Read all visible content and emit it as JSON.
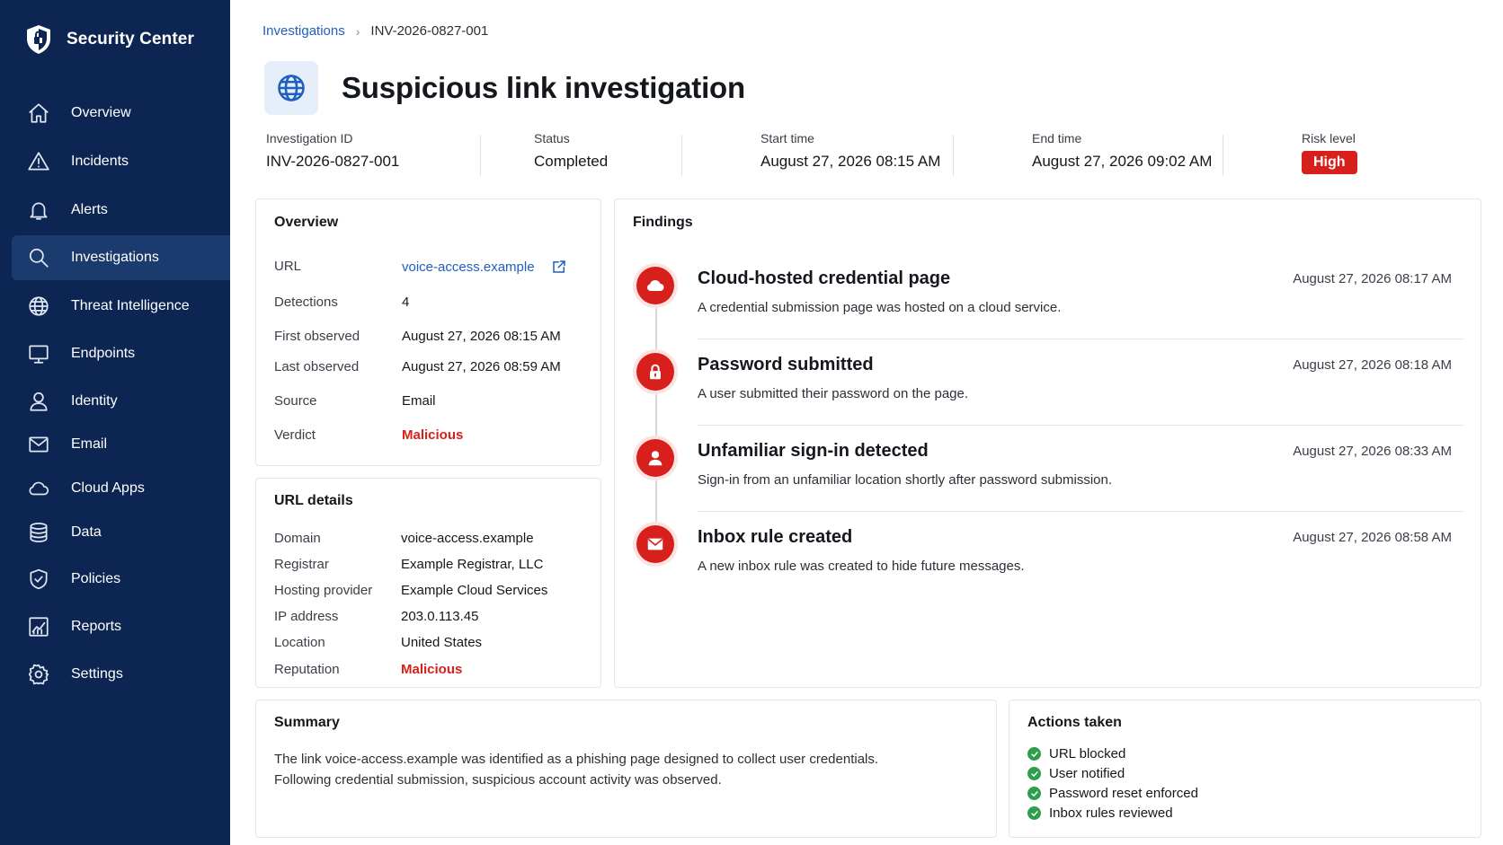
{
  "app": {
    "name": "Security Center"
  },
  "sidebar": {
    "items": [
      {
        "label": "Overview",
        "icon": "home-icon"
      },
      {
        "label": "Incidents",
        "icon": "warning-icon"
      },
      {
        "label": "Alerts",
        "icon": "bell-icon"
      },
      {
        "label": "Investigations",
        "icon": "search-icon",
        "active": true
      },
      {
        "label": "Threat Intelligence",
        "icon": "globe-icon"
      },
      {
        "label": "Endpoints",
        "icon": "monitor-icon"
      },
      {
        "label": "Identity",
        "icon": "user-icon"
      },
      {
        "label": "Email",
        "icon": "mail-icon"
      },
      {
        "label": "Cloud Apps",
        "icon": "cloud-icon"
      },
      {
        "label": "Data",
        "icon": "database-icon"
      },
      {
        "label": "Policies",
        "icon": "shield-check-icon"
      },
      {
        "label": "Reports",
        "icon": "chart-icon"
      },
      {
        "label": "Settings",
        "icon": "gear-icon"
      }
    ]
  },
  "breadcrumb": {
    "parent": "Investigations",
    "current": "INV-2026-0827-001"
  },
  "page": {
    "title": "Suspicious link investigation",
    "icon": "globe-icon"
  },
  "meta": {
    "investigation_id": {
      "label": "Investigation ID",
      "value": "INV-2026-0827-001"
    },
    "status": {
      "label": "Status",
      "value": "Completed"
    },
    "start_time": {
      "label": "Start time",
      "value": "August 27, 2026 08:15 AM"
    },
    "end_time": {
      "label": "End time",
      "value": "August 27, 2026 09:02 AM"
    },
    "risk_level": {
      "label": "Risk level",
      "value": "High"
    }
  },
  "overview": {
    "title": "Overview",
    "rows": [
      {
        "label": "URL",
        "value": "voice-access.example"
      },
      {
        "label": "Detections",
        "value": "4"
      },
      {
        "label": "First observed",
        "value": "August 27, 2026 08:15 AM"
      },
      {
        "label": "Last observed",
        "value": "August 27, 2026 08:59 AM"
      },
      {
        "label": "Source",
        "value": "Email"
      },
      {
        "label": "Verdict",
        "value": "Malicious"
      }
    ]
  },
  "url_details": {
    "title": "URL details",
    "rows": [
      {
        "label": "Domain",
        "value": "voice-access.example"
      },
      {
        "label": "Registrar",
        "value": "Example Registrar, LLC"
      },
      {
        "label": "Hosting provider",
        "value": "Example Cloud Services"
      },
      {
        "label": "IP address",
        "value": "203.0.113.45"
      },
      {
        "label": "Location",
        "value": "United States"
      },
      {
        "label": "Reputation",
        "value": "Malicious"
      }
    ]
  },
  "findings": {
    "title": "Findings",
    "items": [
      {
        "title": "Cloud-hosted credential page",
        "description": "A credential submission page was hosted on a cloud service.",
        "time": "August 27, 2026 08:17 AM",
        "icon": "cloud-icon"
      },
      {
        "title": "Password submitted",
        "description": "A user submitted their password on the page.",
        "time": "August 27, 2026 08:18 AM",
        "icon": "lock-icon"
      },
      {
        "title": "Unfamiliar sign-in detected",
        "description": "Sign-in from an unfamiliar location shortly after password submission.",
        "time": "August 27, 2026 08:33 AM",
        "icon": "user-icon"
      },
      {
        "title": "Inbox rule created",
        "description": "A new inbox rule was created to hide future messages.",
        "time": "August 27, 2026 08:58 AM",
        "icon": "mail-icon"
      }
    ]
  },
  "summary": {
    "title": "Summary",
    "line1": "The link voice-access.example was identified as a phishing page designed to collect user credentials.",
    "line2": "Following credential submission, suspicious account activity was observed."
  },
  "actions": {
    "title": "Actions taken",
    "items": [
      "URL blocked",
      "User notified",
      "Password reset enforced",
      "Inbox rules reviewed"
    ]
  },
  "colors": {
    "sidebar": "#0d2552",
    "sidebar_active": "#1b3a6e",
    "accent": "#1f5fbf",
    "danger": "#d7201b",
    "success": "#2e9e4d"
  }
}
